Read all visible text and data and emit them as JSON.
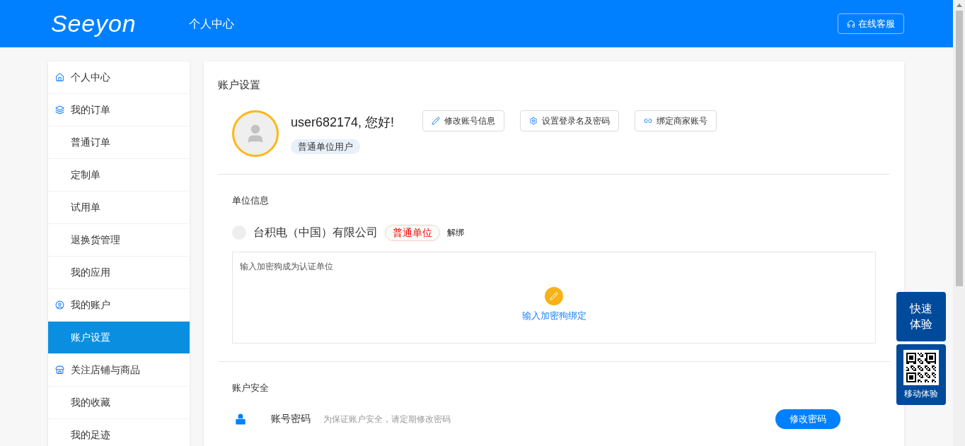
{
  "header": {
    "logo": "Seeyon",
    "title": "个人中心",
    "service_button": "在线客服"
  },
  "sidebar": {
    "items": [
      {
        "label": "个人中心",
        "kind": "group",
        "selected": false
      },
      {
        "label": "我的订单",
        "kind": "group",
        "selected": false
      },
      {
        "label": "普通订单",
        "kind": "sub",
        "selected": false
      },
      {
        "label": "定制单",
        "kind": "sub",
        "selected": false
      },
      {
        "label": "试用单",
        "kind": "sub",
        "selected": false
      },
      {
        "label": "退换货管理",
        "kind": "sub",
        "selected": false
      },
      {
        "label": "我的应用",
        "kind": "sub",
        "selected": false
      },
      {
        "label": "我的账户",
        "kind": "group",
        "selected": false
      },
      {
        "label": "账户设置",
        "kind": "sub",
        "selected": true
      },
      {
        "label": "关注店铺与商品",
        "kind": "group",
        "selected": false
      },
      {
        "label": "我的收藏",
        "kind": "sub",
        "selected": false
      },
      {
        "label": "我的足迹",
        "kind": "sub",
        "selected": false
      }
    ]
  },
  "main": {
    "title": "账户设置",
    "profile": {
      "greeting": "user682174, 您好!",
      "role": "普通单位用户",
      "actions": [
        "修改账号信息",
        "设置登录名及密码",
        "绑定商家账号"
      ]
    },
    "unit": {
      "heading": "单位信息",
      "company": "台积电（中国）有限公司",
      "badge": "普通单位",
      "unbind": "解绑",
      "hint": "输入加密狗成为认证单位",
      "bind_action": "输入加密狗绑定"
    },
    "security": {
      "heading": "账户安全",
      "label": "账号密码",
      "description": "为保证账户安全，请定期修改密码",
      "button": "修改密码"
    }
  },
  "float": {
    "quick": "快速体验",
    "mobile": "移动体验"
  }
}
